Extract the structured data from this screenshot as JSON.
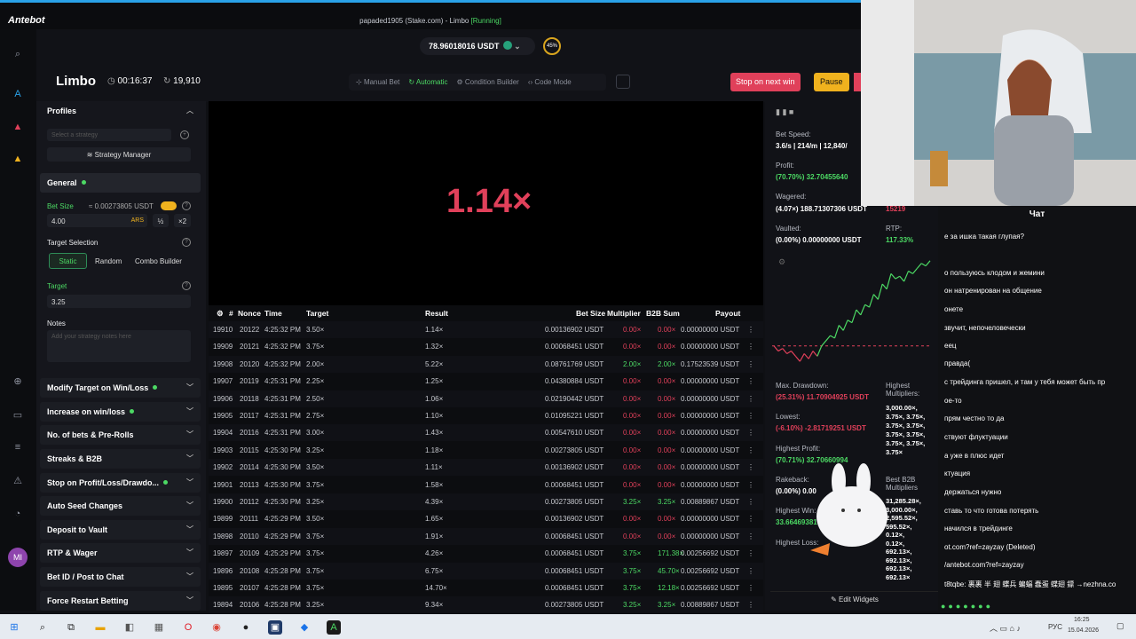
{
  "app": {
    "brand": "Antebot",
    "title_prefix": "papaded1905 (Stake.com) - Limbo ",
    "title_status": "[Running]"
  },
  "header": {
    "balance": "78.96018016 USDT",
    "percent": "45%",
    "game": "Limbo",
    "time": "00:16:37",
    "bets": "19,910",
    "modes": [
      "Manual Bet",
      "Automatic",
      "Condition Builder",
      "Code Mode"
    ],
    "stop_label": "Stop on next win",
    "pause_label": "Pause"
  },
  "sidebar": {
    "profiles": "Profiles",
    "strategy_placeholder": "Select a strategy",
    "strategy_manager": "Strategy Manager",
    "general": "General",
    "bet_size_label": "Bet Size",
    "bet_size_usdt": "≈ 0.00273805 USDT",
    "bet_value": "4.00",
    "bet_currency": "ARS",
    "half": "½",
    "double": "×2",
    "target_selection": "Target Selection",
    "target_modes": [
      "Static",
      "Random",
      "Combo Builder"
    ],
    "target_label": "Target",
    "target_value": "3.25",
    "notes_label": "Notes",
    "notes_placeholder": "Add your strategy notes here",
    "sections": [
      "Modify Target on Win/Loss",
      "Increase on win/loss",
      "No. of bets & Pre-Rolls",
      "Streaks & B2B",
      "Stop on Profit/Loss/Drawdo...",
      "Auto Seed Changes",
      "Deposit to Vault",
      "RTP & Wager",
      "Bet ID / Post to Chat",
      "Force Restart Betting"
    ]
  },
  "game": {
    "multiplier": "1.14×"
  },
  "table": {
    "headers": [
      "#",
      "Nonce",
      "Time",
      "Target",
      "Result",
      "Bet Size",
      "Multiplier",
      "B2B Sum",
      "Payout"
    ],
    "rows": [
      [
        "19910",
        "20122",
        "4:25:32 PM",
        "3.50×",
        "1.14×",
        "0.00136902 USDT",
        "0.00×",
        "0.00×",
        "0.00000000 USDT",
        0
      ],
      [
        "19909",
        "20121",
        "4:25:32 PM",
        "3.75×",
        "1.32×",
        "0.00068451 USDT",
        "0.00×",
        "0.00×",
        "0.00000000 USDT",
        0
      ],
      [
        "19908",
        "20120",
        "4:25:32 PM",
        "2.00×",
        "5.22×",
        "0.08761769 USDT",
        "2.00×",
        "2.00×",
        "0.17523539 USDT",
        1
      ],
      [
        "19907",
        "20119",
        "4:25:31 PM",
        "2.25×",
        "1.25×",
        "0.04380884 USDT",
        "0.00×",
        "0.00×",
        "0.00000000 USDT",
        0
      ],
      [
        "19906",
        "20118",
        "4:25:31 PM",
        "2.50×",
        "1.06×",
        "0.02190442 USDT",
        "0.00×",
        "0.00×",
        "0.00000000 USDT",
        0
      ],
      [
        "19905",
        "20117",
        "4:25:31 PM",
        "2.75×",
        "1.10×",
        "0.01095221 USDT",
        "0.00×",
        "0.00×",
        "0.00000000 USDT",
        0
      ],
      [
        "19904",
        "20116",
        "4:25:31 PM",
        "3.00×",
        "1.43×",
        "0.00547610 USDT",
        "0.00×",
        "0.00×",
        "0.00000000 USDT",
        0
      ],
      [
        "19903",
        "20115",
        "4:25:30 PM",
        "3.25×",
        "1.18×",
        "0.00273805 USDT",
        "0.00×",
        "0.00×",
        "0.00000000 USDT",
        0
      ],
      [
        "19902",
        "20114",
        "4:25:30 PM",
        "3.50×",
        "1.11×",
        "0.00136902 USDT",
        "0.00×",
        "0.00×",
        "0.00000000 USDT",
        0
      ],
      [
        "19901",
        "20113",
        "4:25:30 PM",
        "3.75×",
        "1.58×",
        "0.00068451 USDT",
        "0.00×",
        "0.00×",
        "0.00000000 USDT",
        0
      ],
      [
        "19900",
        "20112",
        "4:25:30 PM",
        "3.25×",
        "4.39×",
        "0.00273805 USDT",
        "3.25×",
        "3.25×",
        "0.00889867 USDT",
        1
      ],
      [
        "19899",
        "20111",
        "4:25:29 PM",
        "3.50×",
        "1.65×",
        "0.00136902 USDT",
        "0.00×",
        "0.00×",
        "0.00000000 USDT",
        0
      ],
      [
        "19898",
        "20110",
        "4:25:29 PM",
        "3.75×",
        "1.91×",
        "0.00068451 USDT",
        "0.00×",
        "0.00×",
        "0.00000000 USDT",
        0
      ],
      [
        "19897",
        "20109",
        "4:25:29 PM",
        "3.75×",
        "4.26×",
        "0.00068451 USDT",
        "3.75×",
        "171.38×",
        "0.00256692 USDT",
        1
      ],
      [
        "19896",
        "20108",
        "4:25:28 PM",
        "3.75×",
        "6.75×",
        "0.00068451 USDT",
        "3.75×",
        "45.70×",
        "0.00256692 USDT",
        1
      ],
      [
        "19895",
        "20107",
        "4:25:28 PM",
        "3.75×",
        "14.70×",
        "0.00068451 USDT",
        "3.75×",
        "12.18×",
        "0.00256692 USDT",
        1
      ],
      [
        "19894",
        "20106",
        "4:25:28 PM",
        "3.25×",
        "9.34×",
        "0.00273805 USDT",
        "3.25×",
        "3.25×",
        "0.00889867 USDT",
        1
      ]
    ]
  },
  "stats": {
    "bet_speed_label": "Bet Speed:",
    "bet_speed": "3.6/s | 214/m | 12,840/",
    "profit_label": "Profit:",
    "profit": "(70.70%) 32.70455640",
    "wagered_label": "Wagered:",
    "wagered": "(4.07×) 188.71307306 USDT",
    "wagered_extra": "15219",
    "vaulted_label": "Vaulted:",
    "vaulted": "(0.00%) 0.00000000 USDT",
    "rtp_label": "RTP:",
    "rtp": "117.33%",
    "maxdd_label": "Max. Drawdown:",
    "maxdd": "(25.31%) 11.70904925 USDT",
    "lowest_label": "Lowest:",
    "lowest": "(-6.10%) -2.81719251 USDT",
    "highest_profit_label": "Highest Profit:",
    "highest_profit": "(70.71%) 32.70660994",
    "rakeback_label": "Rakeback:",
    "rakeback": "(0.00%) 0.00",
    "highest_win_label": "Highest Win:",
    "highest_win": "33.66469381",
    "highest_loss_label": "Highest Loss:",
    "highest_mult_label": "Highest Multipliers:",
    "highest_mult": [
      "3,000.00×,",
      "3.75×, 3.75×,",
      "3.75×, 3.75×,",
      "3.75×, 3.75×,",
      "3.75×, 3.75×,",
      "3.75×"
    ],
    "b2b_label": "Best B2B Multipliers",
    "b2b": [
      "31,285.28×,",
      "3,000.00×,",
      "2,595.52×,",
      "595.52×,",
      "0.12×,",
      "0.12×,",
      "692.13×,",
      "692.13×,",
      "692.13×,",
      "692.13×"
    ],
    "edit_widgets": "Edit Widgets"
  },
  "chart_data": {
    "type": "line",
    "series": [
      {
        "values": [
          0,
          -2,
          -1,
          -3,
          -2,
          -4,
          -6,
          -3,
          -5,
          -2,
          -4,
          0,
          2,
          4,
          3,
          8,
          6,
          10,
          9,
          14,
          12,
          16,
          15,
          20,
          18,
          24,
          22,
          28,
          26,
          27,
          25,
          29,
          28,
          30,
          32,
          31,
          33
        ]
      }
    ],
    "baseline": 0
  },
  "chat": {
    "title": "Чат",
    "messages": [
      "е за ишка такая глупая?",
      "о пользуюсь клодом и жемини",
      "он натренирован на общение",
      "онете",
      "звучит, непочеловечески",
      "еец",
      "правда(",
      "с трейдинга пришел, и там у тебя может быть пр",
      "ое-то",
      "прям честно то да",
      "ствуют флуктуации",
      "а уже в плюс идет",
      "ктуация",
      "держаться нужно",
      "ставь то что готова потерять",
      "начился в трейдинге",
      "ot.com?ref=zayzay (Deleted)",
      "/antebot.com?ref=zayzay",
      "t8tqbe: 裹裹 半 翅 蝶兵 蝙蝠 蠢蛋 蝶翅 鏢 →nezhna.co"
    ]
  },
  "taskbar": {
    "lang": "РУС",
    "time": "16:25",
    "date": "15.04.2026"
  },
  "colors": {
    "accent": "#2aa2e8",
    "win": "#4cd964",
    "loss": "#e0405a",
    "pause": "#f0b21e"
  }
}
